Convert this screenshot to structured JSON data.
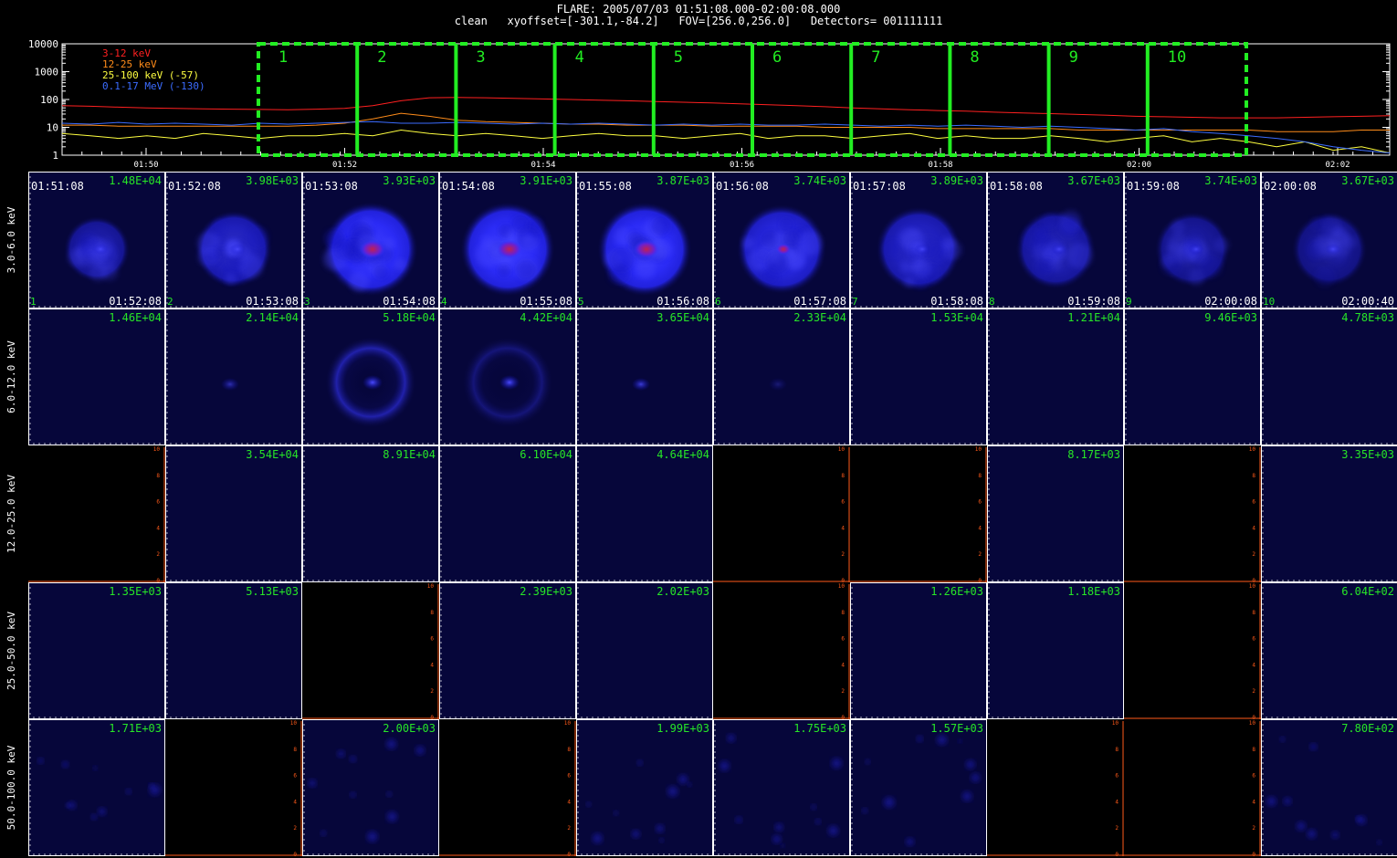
{
  "header": {
    "title": "FLARE: 2005/07/03 01:51:08.000-02:00:08.000",
    "subtitle": "clean   xyoffset=[-301.1,-84.2]   FOV=[256.0,256.0]   Detectors= 001111111"
  },
  "lightcurve": {
    "ytick_labels": [
      "10000",
      "1000",
      "100",
      "10",
      "1"
    ],
    "xtick_labels": [
      "01:50",
      "01:52",
      "01:54",
      "01:56",
      "01:58",
      "02:00",
      "02:02"
    ],
    "legend": [
      {
        "label": "3-12 keV",
        "color": "#ff2020"
      },
      {
        "label": "12-25 keV",
        "color": "#ff8c1a"
      },
      {
        "label": "25-100 keV (-57)",
        "color": "#ffff40"
      },
      {
        "label": "0.1-17 MeV (-130)",
        "color": "#3b6cff"
      }
    ],
    "interval_labels": [
      "1",
      "2",
      "3",
      "4",
      "5",
      "6",
      "7",
      "8",
      "9",
      "10"
    ],
    "series_levels": {
      "3-12 keV": [
        60,
        57,
        53,
        50,
        48,
        46,
        45,
        44,
        43,
        45,
        48,
        60,
        90,
        115,
        118,
        115,
        110,
        105,
        100,
        95,
        90,
        85,
        80,
        75,
        70,
        65,
        60,
        55,
        50,
        46,
        43,
        40,
        38,
        35,
        33,
        31,
        29,
        27,
        25,
        24,
        23,
        22,
        22,
        22,
        23,
        24,
        25,
        26
      ],
      "12-25 keV": [
        12,
        12,
        11,
        11,
        11,
        11,
        11,
        11,
        11,
        12,
        14,
        20,
        32,
        25,
        18,
        16,
        15,
        14,
        13,
        13,
        12,
        12,
        12,
        11,
        11,
        11,
        11,
        10,
        10,
        10,
        10,
        9,
        9,
        9,
        9,
        9,
        8,
        8,
        8,
        8,
        8,
        8,
        8,
        7,
        7,
        7,
        8,
        8
      ],
      "25-100 keV (-57)": [
        6,
        5,
        4,
        5,
        4,
        6,
        5,
        4,
        5,
        5,
        6,
        5,
        8,
        6,
        5,
        6,
        5,
        4,
        5,
        6,
        5,
        5,
        4,
        5,
        6,
        4,
        5,
        5,
        4,
        5,
        6,
        4,
        5,
        4,
        4,
        5,
        4,
        3,
        4,
        5,
        3,
        4,
        3,
        2,
        3,
        1.5,
        2,
        1.2
      ],
      "0.1-17 MeV (-130)": [
        14,
        13,
        15,
        13,
        14,
        13,
        12,
        14,
        13,
        14,
        15,
        16,
        14,
        14,
        15,
        14,
        13,
        14,
        13,
        14,
        13,
        12,
        13,
        12,
        13,
        12,
        12,
        13,
        12,
        11,
        12,
        11,
        12,
        11,
        10,
        11,
        10,
        9,
        8,
        9,
        7,
        6,
        5,
        4,
        3,
        2,
        1.5,
        1.2
      ]
    }
  },
  "energy_rows": [
    {
      "label": "3.0-6.0 keV",
      "panels": [
        {
          "max": "1.48E+04",
          "start": "01:51:08",
          "end": "01:52:08",
          "index": "1",
          "kind": "image",
          "intensity": 0.55,
          "size": 0.7,
          "core": 0
        },
        {
          "max": "3.98E+03",
          "start": "01:52:08",
          "end": "01:53:08",
          "index": "2",
          "kind": "image",
          "intensity": 0.7,
          "size": 0.82,
          "core": 0
        },
        {
          "max": "3.93E+03",
          "start": "01:53:08",
          "end": "01:54:08",
          "index": "3",
          "kind": "image",
          "intensity": 1.0,
          "size": 1.0,
          "core": 1
        },
        {
          "max": "3.91E+03",
          "start": "01:54:08",
          "end": "01:55:08",
          "index": "4",
          "kind": "image",
          "intensity": 1.0,
          "size": 1.0,
          "core": 1
        },
        {
          "max": "3.87E+03",
          "start": "01:55:08",
          "end": "01:56:08",
          "index": "5",
          "kind": "image",
          "intensity": 1.0,
          "size": 1.0,
          "core": 1
        },
        {
          "max": "3.74E+03",
          "start": "01:56:08",
          "end": "01:57:08",
          "index": "6",
          "kind": "image",
          "intensity": 0.85,
          "size": 0.95,
          "core": 0.5
        },
        {
          "max": "3.89E+03",
          "start": "01:57:08",
          "end": "01:58:08",
          "index": "7",
          "kind": "image",
          "intensity": 0.7,
          "size": 0.9,
          "core": 0
        },
        {
          "max": "3.67E+03",
          "start": "01:58:08",
          "end": "01:59:08",
          "index": "8",
          "kind": "image",
          "intensity": 0.6,
          "size": 0.85,
          "core": 0
        },
        {
          "max": "3.74E+03",
          "start": "01:59:08",
          "end": "02:00:08",
          "index": "9",
          "kind": "image",
          "intensity": 0.5,
          "size": 0.8,
          "core": 0
        },
        {
          "max": "3.67E+03",
          "start": "02:00:08",
          "end": "02:00:40",
          "index": "10",
          "kind": "image",
          "intensity": 0.45,
          "size": 0.8,
          "core": 0
        }
      ]
    },
    {
      "label": "6.0-12.0 keV",
      "panels": [
        {
          "max": "1.46E+04",
          "kind": "blank"
        },
        {
          "max": "2.14E+04",
          "kind": "spot",
          "intensity": 0.6
        },
        {
          "max": "5.18E+04",
          "kind": "ring",
          "intensity": 0.9
        },
        {
          "max": "4.42E+04",
          "kind": "ring",
          "intensity": 0.5
        },
        {
          "max": "3.65E+04",
          "kind": "spot",
          "intensity": 0.8
        },
        {
          "max": "2.33E+04",
          "kind": "spot",
          "intensity": 0.3
        },
        {
          "max": "1.53E+04",
          "kind": "blank"
        },
        {
          "max": "1.21E+04",
          "kind": "blank"
        },
        {
          "max": "9.46E+03",
          "kind": "blank"
        },
        {
          "max": "4.78E+03",
          "kind": "blank"
        }
      ]
    },
    {
      "label": "12.0-25.0 keV",
      "panels": [
        {
          "max": "",
          "kind": "empty"
        },
        {
          "max": "3.54E+04",
          "kind": "blank"
        },
        {
          "max": "8.91E+04",
          "kind": "blank"
        },
        {
          "max": "6.10E+04",
          "kind": "blank"
        },
        {
          "max": "4.64E+04",
          "kind": "blank"
        },
        {
          "max": "",
          "kind": "empty"
        },
        {
          "max": "",
          "kind": "empty"
        },
        {
          "max": "8.17E+03",
          "kind": "blank"
        },
        {
          "max": "",
          "kind": "empty"
        },
        {
          "max": "3.35E+03",
          "kind": "blank"
        }
      ]
    },
    {
      "label": "25.0-50.0 keV",
      "panels": [
        {
          "max": "1.35E+03",
          "kind": "blank"
        },
        {
          "max": "5.13E+03",
          "kind": "blank"
        },
        {
          "max": "",
          "kind": "empty"
        },
        {
          "max": "2.39E+03",
          "kind": "blank"
        },
        {
          "max": "2.02E+03",
          "kind": "blank"
        },
        {
          "max": "",
          "kind": "empty"
        },
        {
          "max": "1.26E+03",
          "kind": "blank"
        },
        {
          "max": "1.18E+03",
          "kind": "blank"
        },
        {
          "max": "",
          "kind": "empty"
        },
        {
          "max": "6.04E+02",
          "kind": "blank"
        }
      ]
    },
    {
      "label": "50.0-100.0 keV",
      "panels": [
        {
          "max": "1.71E+03",
          "kind": "noise"
        },
        {
          "max": "",
          "kind": "empty"
        },
        {
          "max": "2.00E+03",
          "kind": "noise"
        },
        {
          "max": "",
          "kind": "empty"
        },
        {
          "max": "1.99E+03",
          "kind": "noise"
        },
        {
          "max": "1.75E+03",
          "kind": "noise"
        },
        {
          "max": "1.57E+03",
          "kind": "noise"
        },
        {
          "max": "",
          "kind": "empty"
        },
        {
          "max": "",
          "kind": "empty"
        },
        {
          "max": "7.80E+02",
          "kind": "noise"
        }
      ]
    }
  ],
  "empty_axis_ticks": [
    "0",
    "2",
    "4",
    "6",
    "8",
    "10"
  ],
  "colors": {
    "background": "#000000",
    "panel_navy": "#06063a",
    "max_label": "#27e627",
    "interval_box": "#22ee22",
    "axis_orange": "#ff5a1a"
  }
}
